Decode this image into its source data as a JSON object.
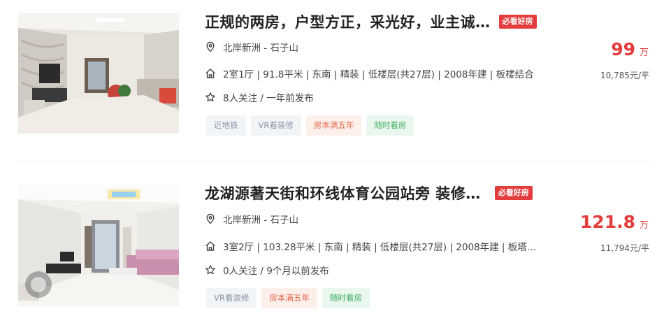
{
  "listings": [
    {
      "title": "正规的两房，户型方正，采光好，业主诚…",
      "badge": "必看好房",
      "location": "北岸新洲 - 石子山",
      "house_info": "2室1厅 | 91.8平米 | 东南 | 精装 | 低楼层(共27层) | 2008年建 | 板楼结合",
      "follow_info": "8人关注 / 一年前发布",
      "tags": [
        {
          "label": "近地铁",
          "style": "grey"
        },
        {
          "label": "VR看装修",
          "style": "grey"
        },
        {
          "label": "房本满五年",
          "style": "orange"
        },
        {
          "label": "随时看房",
          "style": "green"
        }
      ],
      "price": "99",
      "price_unit": "万",
      "unit_price": "10,785元/平"
    },
    {
      "title": "龙湖源著天街和环线体育公园站旁 装修…",
      "badge": "必看好房",
      "location": "北岸新洲 - 石子山",
      "house_info": "3室2厅 | 103.28平米 | 东南 | 精装 | 低楼层(共27层) | 2008年建 | 板塔…",
      "follow_info": "0人关注 / 9个月以前发布",
      "tags": [
        {
          "label": "VR看装修",
          "style": "grey"
        },
        {
          "label": "房本满五年",
          "style": "orange"
        },
        {
          "label": "随时看房",
          "style": "green"
        }
      ],
      "price": "121.8",
      "price_unit": "万",
      "unit_price": "11,794元/平"
    }
  ],
  "colors": {
    "accent_red": "#e33d3d",
    "tag_grey": "#8a95a3",
    "tag_orange": "#e66a4e",
    "tag_green": "#3fae62"
  },
  "icons": {
    "location": "location-pin-icon",
    "house": "house-icon",
    "follow": "star-icon",
    "vr": "vr-badge-icon"
  }
}
